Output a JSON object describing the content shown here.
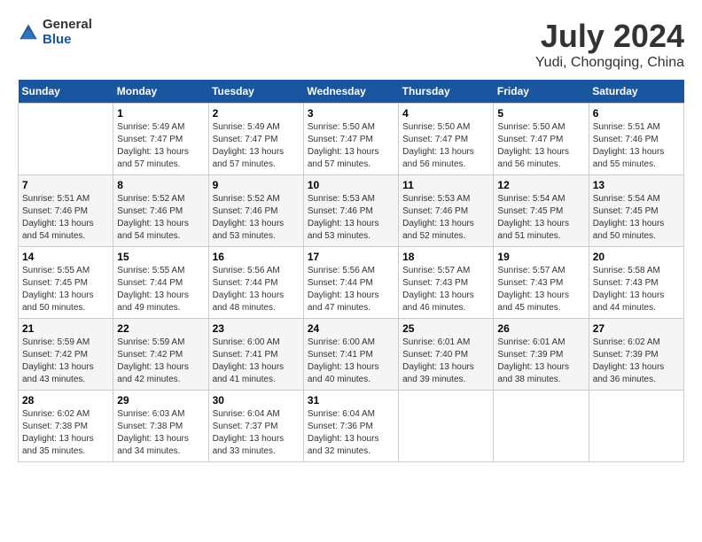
{
  "header": {
    "logo_general": "General",
    "logo_blue": "Blue",
    "month_title": "July 2024",
    "location": "Yudi, Chongqing, China"
  },
  "days_of_week": [
    "Sunday",
    "Monday",
    "Tuesday",
    "Wednesday",
    "Thursday",
    "Friday",
    "Saturday"
  ],
  "weeks": [
    [
      {
        "day": "",
        "info": ""
      },
      {
        "day": "1",
        "info": "Sunrise: 5:49 AM\nSunset: 7:47 PM\nDaylight: 13 hours\nand 57 minutes."
      },
      {
        "day": "2",
        "info": "Sunrise: 5:49 AM\nSunset: 7:47 PM\nDaylight: 13 hours\nand 57 minutes."
      },
      {
        "day": "3",
        "info": "Sunrise: 5:50 AM\nSunset: 7:47 PM\nDaylight: 13 hours\nand 57 minutes."
      },
      {
        "day": "4",
        "info": "Sunrise: 5:50 AM\nSunset: 7:47 PM\nDaylight: 13 hours\nand 56 minutes."
      },
      {
        "day": "5",
        "info": "Sunrise: 5:50 AM\nSunset: 7:47 PM\nDaylight: 13 hours\nand 56 minutes."
      },
      {
        "day": "6",
        "info": "Sunrise: 5:51 AM\nSunset: 7:46 PM\nDaylight: 13 hours\nand 55 minutes."
      }
    ],
    [
      {
        "day": "7",
        "info": "Sunrise: 5:51 AM\nSunset: 7:46 PM\nDaylight: 13 hours\nand 54 minutes."
      },
      {
        "day": "8",
        "info": "Sunrise: 5:52 AM\nSunset: 7:46 PM\nDaylight: 13 hours\nand 54 minutes."
      },
      {
        "day": "9",
        "info": "Sunrise: 5:52 AM\nSunset: 7:46 PM\nDaylight: 13 hours\nand 53 minutes."
      },
      {
        "day": "10",
        "info": "Sunrise: 5:53 AM\nSunset: 7:46 PM\nDaylight: 13 hours\nand 53 minutes."
      },
      {
        "day": "11",
        "info": "Sunrise: 5:53 AM\nSunset: 7:46 PM\nDaylight: 13 hours\nand 52 minutes."
      },
      {
        "day": "12",
        "info": "Sunrise: 5:54 AM\nSunset: 7:45 PM\nDaylight: 13 hours\nand 51 minutes."
      },
      {
        "day": "13",
        "info": "Sunrise: 5:54 AM\nSunset: 7:45 PM\nDaylight: 13 hours\nand 50 minutes."
      }
    ],
    [
      {
        "day": "14",
        "info": "Sunrise: 5:55 AM\nSunset: 7:45 PM\nDaylight: 13 hours\nand 50 minutes."
      },
      {
        "day": "15",
        "info": "Sunrise: 5:55 AM\nSunset: 7:44 PM\nDaylight: 13 hours\nand 49 minutes."
      },
      {
        "day": "16",
        "info": "Sunrise: 5:56 AM\nSunset: 7:44 PM\nDaylight: 13 hours\nand 48 minutes."
      },
      {
        "day": "17",
        "info": "Sunrise: 5:56 AM\nSunset: 7:44 PM\nDaylight: 13 hours\nand 47 minutes."
      },
      {
        "day": "18",
        "info": "Sunrise: 5:57 AM\nSunset: 7:43 PM\nDaylight: 13 hours\nand 46 minutes."
      },
      {
        "day": "19",
        "info": "Sunrise: 5:57 AM\nSunset: 7:43 PM\nDaylight: 13 hours\nand 45 minutes."
      },
      {
        "day": "20",
        "info": "Sunrise: 5:58 AM\nSunset: 7:43 PM\nDaylight: 13 hours\nand 44 minutes."
      }
    ],
    [
      {
        "day": "21",
        "info": "Sunrise: 5:59 AM\nSunset: 7:42 PM\nDaylight: 13 hours\nand 43 minutes."
      },
      {
        "day": "22",
        "info": "Sunrise: 5:59 AM\nSunset: 7:42 PM\nDaylight: 13 hours\nand 42 minutes."
      },
      {
        "day": "23",
        "info": "Sunrise: 6:00 AM\nSunset: 7:41 PM\nDaylight: 13 hours\nand 41 minutes."
      },
      {
        "day": "24",
        "info": "Sunrise: 6:00 AM\nSunset: 7:41 PM\nDaylight: 13 hours\nand 40 minutes."
      },
      {
        "day": "25",
        "info": "Sunrise: 6:01 AM\nSunset: 7:40 PM\nDaylight: 13 hours\nand 39 minutes."
      },
      {
        "day": "26",
        "info": "Sunrise: 6:01 AM\nSunset: 7:39 PM\nDaylight: 13 hours\nand 38 minutes."
      },
      {
        "day": "27",
        "info": "Sunrise: 6:02 AM\nSunset: 7:39 PM\nDaylight: 13 hours\nand 36 minutes."
      }
    ],
    [
      {
        "day": "28",
        "info": "Sunrise: 6:02 AM\nSunset: 7:38 PM\nDaylight: 13 hours\nand 35 minutes."
      },
      {
        "day": "29",
        "info": "Sunrise: 6:03 AM\nSunset: 7:38 PM\nDaylight: 13 hours\nand 34 minutes."
      },
      {
        "day": "30",
        "info": "Sunrise: 6:04 AM\nSunset: 7:37 PM\nDaylight: 13 hours\nand 33 minutes."
      },
      {
        "day": "31",
        "info": "Sunrise: 6:04 AM\nSunset: 7:36 PM\nDaylight: 13 hours\nand 32 minutes."
      },
      {
        "day": "",
        "info": ""
      },
      {
        "day": "",
        "info": ""
      },
      {
        "day": "",
        "info": ""
      }
    ]
  ]
}
